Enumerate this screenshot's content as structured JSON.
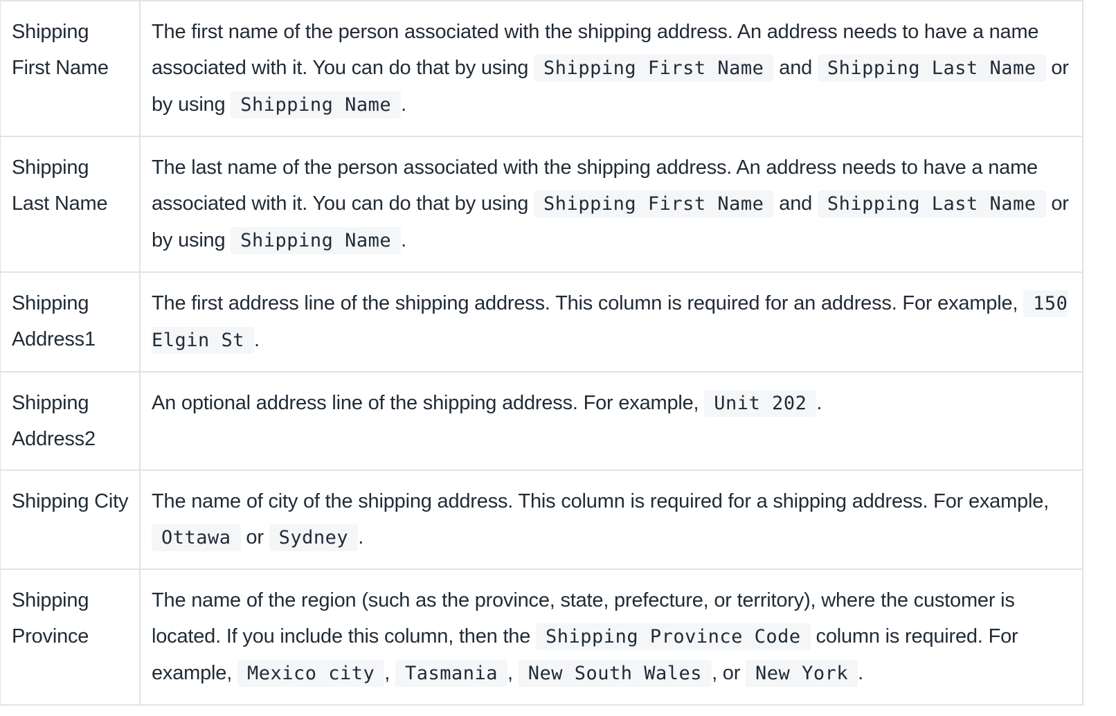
{
  "rows": [
    {
      "label": "Shipping First Name",
      "segments": [
        {
          "t": "The first name of the person associated with the shipping address. An address needs to have a name associated with it. You can do that by using "
        },
        {
          "c": "Shipping First Name"
        },
        {
          "t": " and "
        },
        {
          "c": "Shipping Last Name"
        },
        {
          "t": " or by using "
        },
        {
          "c": "Shipping Name"
        },
        {
          "t": "."
        }
      ]
    },
    {
      "label": "Shipping Last Name",
      "segments": [
        {
          "t": "The last name of the person associated with the shipping address. An address needs to have a name associated with it. You can do that by using "
        },
        {
          "c": "Shipping First Name"
        },
        {
          "t": " and "
        },
        {
          "c": "Shipping Last Name"
        },
        {
          "t": " or by using "
        },
        {
          "c": "Shipping Name"
        },
        {
          "t": "."
        }
      ]
    },
    {
      "label": "Shipping Address1",
      "segments": [
        {
          "t": "The first address line of the shipping address. This column is required for an address. For example, "
        },
        {
          "c": "150 Elgin St"
        },
        {
          "t": "."
        }
      ]
    },
    {
      "label": "Shipping Address2",
      "segments": [
        {
          "t": "An optional address line of the shipping address. For example, "
        },
        {
          "c": "Unit 202"
        },
        {
          "t": "."
        }
      ]
    },
    {
      "label": "Shipping City",
      "segments": [
        {
          "t": "The name of city of the shipping address. This column is required for a shipping address. For example, "
        },
        {
          "c": "Ottawa"
        },
        {
          "t": " or "
        },
        {
          "c": "Sydney"
        },
        {
          "t": "."
        }
      ]
    },
    {
      "label": "Shipping Province",
      "segments": [
        {
          "t": "The name of the region (such as the province, state, prefecture, or territory), where the customer is located. If you include this column, then the "
        },
        {
          "c": "Shipping Province Code"
        },
        {
          "t": " column is required. For example, "
        },
        {
          "c": "Mexico city"
        },
        {
          "t": ", "
        },
        {
          "c": "Tasmania"
        },
        {
          "t": ", "
        },
        {
          "c": "New South Wales"
        },
        {
          "t": ", or "
        },
        {
          "c": "New York"
        },
        {
          "t": "."
        }
      ]
    }
  ]
}
